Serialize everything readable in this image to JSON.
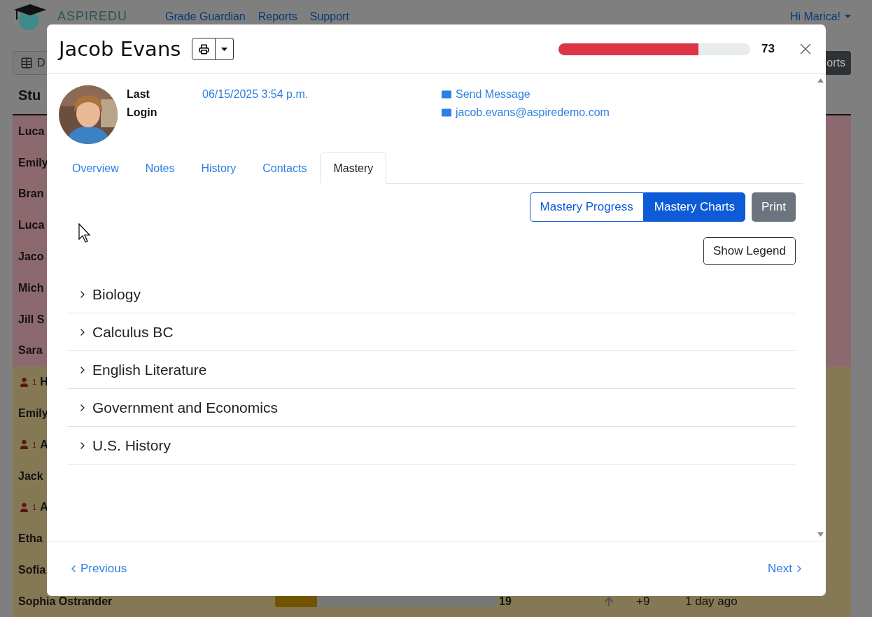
{
  "app": {
    "logo_text": "ASPIREDU",
    "nav": [
      "Grade Guardian",
      "Reports",
      "Support"
    ],
    "greeting": "Hi Marica!"
  },
  "toolbar": {
    "left_button": "D",
    "right_button": "orts"
  },
  "list": {
    "heading": "Stu",
    "rows": [
      {
        "kind": "plain",
        "name": "Luca",
        "color": "#8c696e"
      },
      {
        "kind": "plain",
        "name": "Emily",
        "color": "#8c696e"
      },
      {
        "kind": "plain",
        "name": "Bran",
        "color": "#8c696e"
      },
      {
        "kind": "plain",
        "name": "Luca",
        "color": "#8c696e"
      },
      {
        "kind": "plain",
        "name": "Jaco",
        "color": "#8c696e"
      },
      {
        "kind": "plain",
        "name": "Mich",
        "color": "#8c696e"
      },
      {
        "kind": "plain",
        "name": "Jill S",
        "color": "#8c696e"
      },
      {
        "kind": "plain",
        "name": "Sara",
        "color": "#8c696e"
      },
      {
        "kind": "flagged",
        "flag_count": "1",
        "name": "H",
        "color": "#857955"
      },
      {
        "kind": "plain",
        "name": "Emily",
        "color": "#857955"
      },
      {
        "kind": "flagged",
        "flag_count": "1",
        "name": "A",
        "color": "#857955"
      },
      {
        "kind": "plain",
        "name": "Jack",
        "color": "#857955"
      },
      {
        "kind": "flagged",
        "flag_count": "1",
        "name": "A",
        "color": "#857955"
      },
      {
        "kind": "plain",
        "name": "Etha",
        "color": "#857955"
      },
      {
        "kind": "plain",
        "name": "Sofia",
        "color": "#857955"
      },
      {
        "kind": "full",
        "name": "Sophia Ostrander",
        "color": "#857955",
        "level": 0.19,
        "score": "19",
        "change": "+9",
        "last_seen": "1 day ago"
      }
    ]
  },
  "student_modal": {
    "name": "Jacob Evans",
    "score": {
      "level": 0.73,
      "value": "73"
    },
    "last_login_label": "Last Login",
    "last_login": "06/15/2025 3:54 p.m.",
    "links": [
      "Send Message",
      "jacob.evans@aspiredemo.com"
    ],
    "tabs": [
      {
        "label": "Overview",
        "selected": false
      },
      {
        "label": "Notes",
        "selected": false
      },
      {
        "label": "History",
        "selected": false
      },
      {
        "label": "Contacts",
        "selected": false
      },
      {
        "label": "Mastery",
        "selected": true
      }
    ],
    "view_buttons": [
      {
        "label": "Mastery Progress",
        "selected": false
      },
      {
        "label": "Mastery Charts",
        "selected": true
      }
    ],
    "print_button": "Print",
    "legend_button": "Show Legend",
    "subjects": [
      {
        "name": "Biology",
        "expanded": false
      },
      {
        "name": "Calculus BC",
        "expanded": false
      },
      {
        "name": "English Literature",
        "expanded": false
      },
      {
        "name": "Government and Economics",
        "expanded": false
      },
      {
        "name": "U.S. History",
        "expanded": false
      }
    ],
    "footer": {
      "previous": "Previous",
      "next": "Next"
    }
  }
}
